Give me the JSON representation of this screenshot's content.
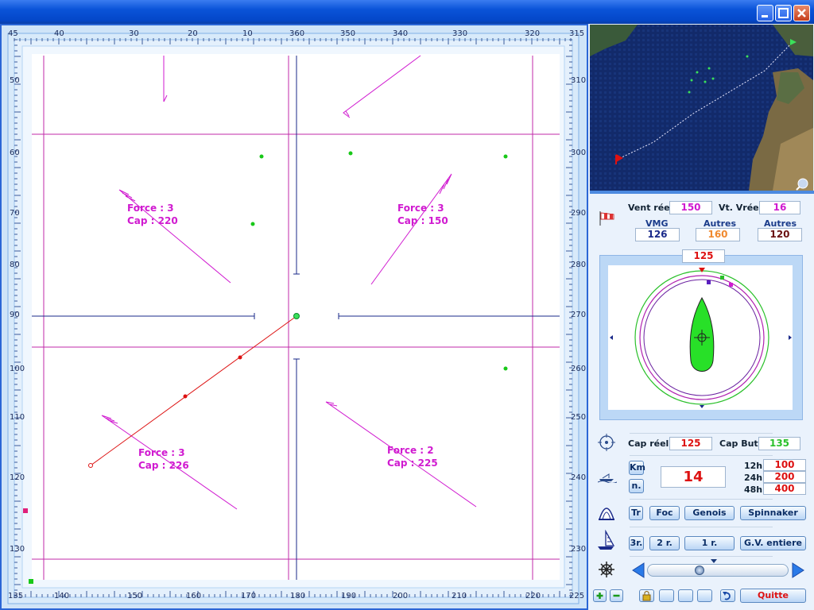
{
  "top_scale": [
    "45",
    "40",
    "30",
    "20",
    "10",
    "360",
    "350",
    "340",
    "330",
    "320",
    "315"
  ],
  "bottom_scale": [
    "135",
    "140",
    "150",
    "160",
    "170",
    "180",
    "190",
    "200",
    "210",
    "220",
    "225"
  ],
  "left_scale": [
    "50",
    "60",
    "70",
    "80",
    "90",
    "100",
    "110",
    "120",
    "130"
  ],
  "right_scale": [
    "310",
    "300",
    "290",
    "280",
    "270",
    "260",
    "250",
    "240",
    "230"
  ],
  "wind_labels": [
    {
      "force": "Force :  3",
      "cap": "Cap    : 220"
    },
    {
      "force": "Force :  3",
      "cap": "Cap    :  150"
    },
    {
      "force": "Force :  3",
      "cap": "Cap    : 226"
    },
    {
      "force": "Force :  2",
      "cap": "Cap    : 225"
    }
  ],
  "panel": {
    "vent_reel_label": "Vent réel",
    "vent_reel_value": "150",
    "vt_vreel_label": "Vt. Vréel",
    "vt_vreel_value": "16",
    "vmg_label": "VMG",
    "vmg_value": "126",
    "autres1_label": "Autres",
    "autres1_value": "160",
    "autres2_label": "Autres",
    "autres2_value": "120",
    "compass_value": "125",
    "cap_reel_label": "Cap réel",
    "cap_reel_value": "125",
    "cap_but_label": "Cap But",
    "cap_but_value": "135",
    "km_label": "Km",
    "n_label": "n.",
    "speed_value": "14",
    "h12_label": "12h",
    "h12_value": "100",
    "h24_label": "24h",
    "h24_value": "200",
    "h48_label": "48h",
    "h48_value": "400",
    "sails": [
      "Tr",
      "Foc",
      "Genois",
      "Spinnaker"
    ],
    "reefs": [
      "3r.",
      "2 r.",
      "1 r.",
      "G.V. entiere"
    ],
    "quit_label": "Quitte"
  },
  "colors": {
    "magenta": "#d01ad0",
    "grid": "#c02aa8",
    "route": "#d11",
    "navy": "#1a2a8a",
    "green": "#18c818"
  }
}
